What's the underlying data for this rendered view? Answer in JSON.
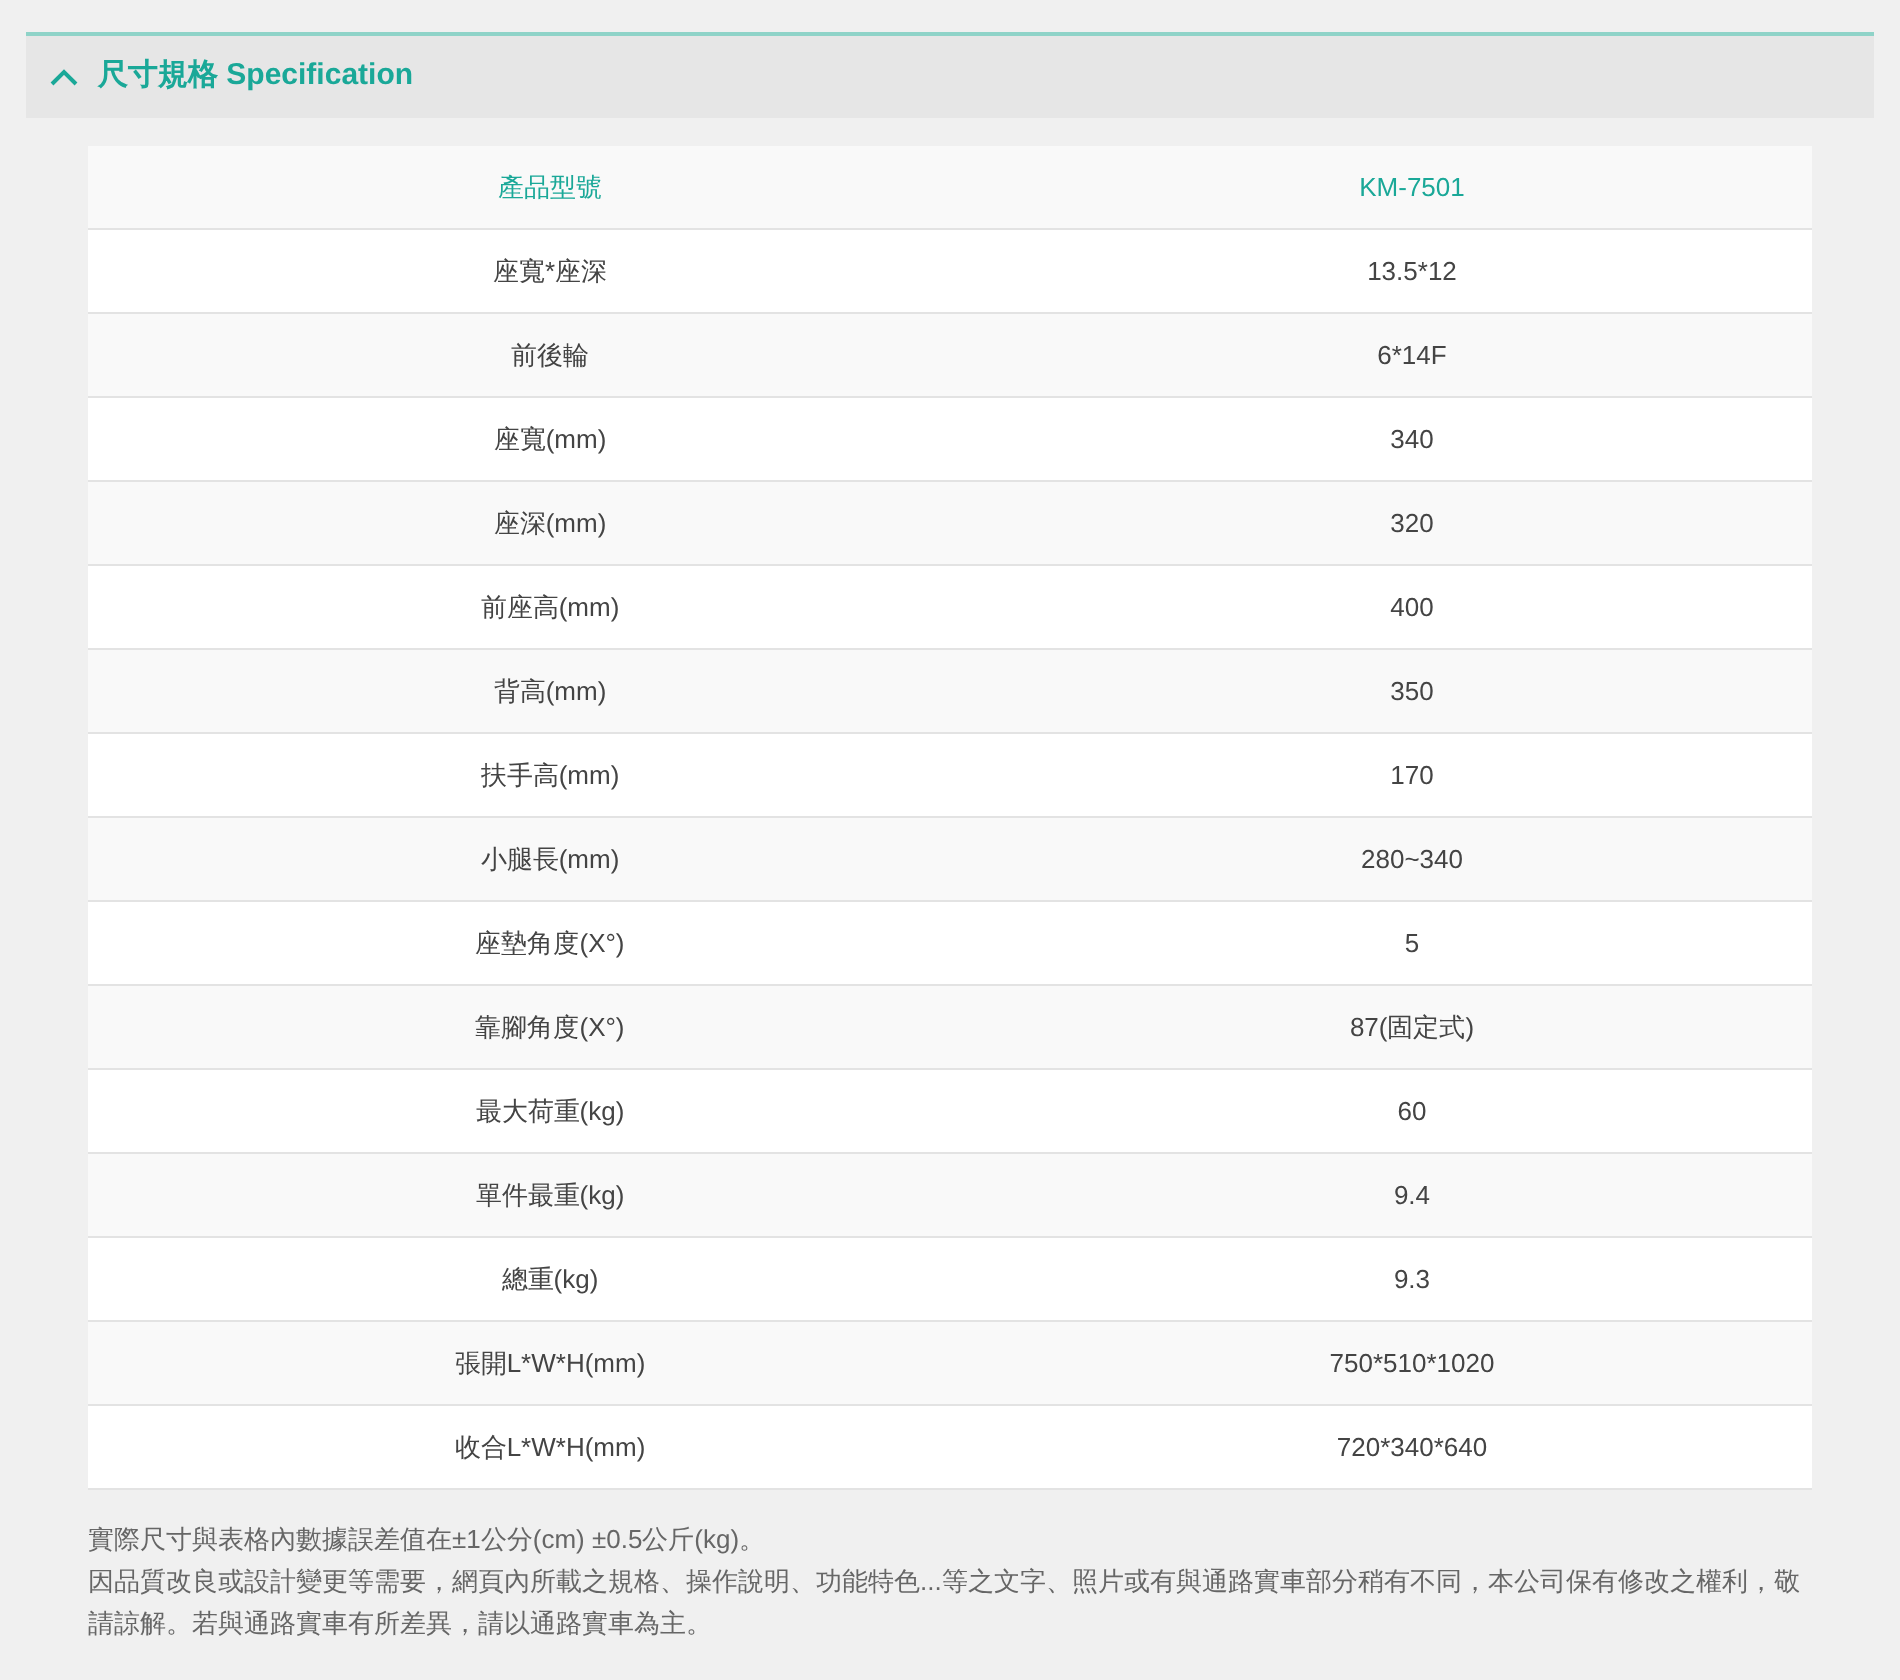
{
  "section": {
    "title": "尺寸規格 Specification",
    "expanded": true
  },
  "table": {
    "columns": [
      "產品型號",
      "KM-7501"
    ],
    "rows": [
      [
        "座寬*座深",
        "13.5*12"
      ],
      [
        "前後輪",
        "6*14F"
      ],
      [
        "座寬(mm)",
        "340"
      ],
      [
        "座深(mm)",
        "320"
      ],
      [
        "前座高(mm)",
        "400"
      ],
      [
        "背高(mm)",
        "350"
      ],
      [
        "扶手高(mm)",
        "170"
      ],
      [
        "小腿長(mm)",
        "280~340"
      ],
      [
        "座墊角度(X°)",
        "5"
      ],
      [
        "靠腳角度(X°)",
        "87(固定式)"
      ],
      [
        "最大荷重(kg)",
        "60"
      ],
      [
        "單件最重(kg)",
        "9.4"
      ],
      [
        "總重(kg)",
        "9.3"
      ],
      [
        "張開L*W*H(mm)",
        "750*510*1020"
      ],
      [
        "收合L*W*H(mm)",
        "720*340*640"
      ]
    ]
  },
  "notes": [
    "實際尺寸與表格內數據誤差值在±1公分(cm) ±0.5公斤(kg)。",
    "因品質改良或設計變更等需要，網頁內所載之規格、操作說明、功能特色...等之文字、照片或有與通路實車部分稍有不同，本公司保有修改之權利，敬請諒解。若與通路實車有所差異，請以通路實車為主。"
  ]
}
